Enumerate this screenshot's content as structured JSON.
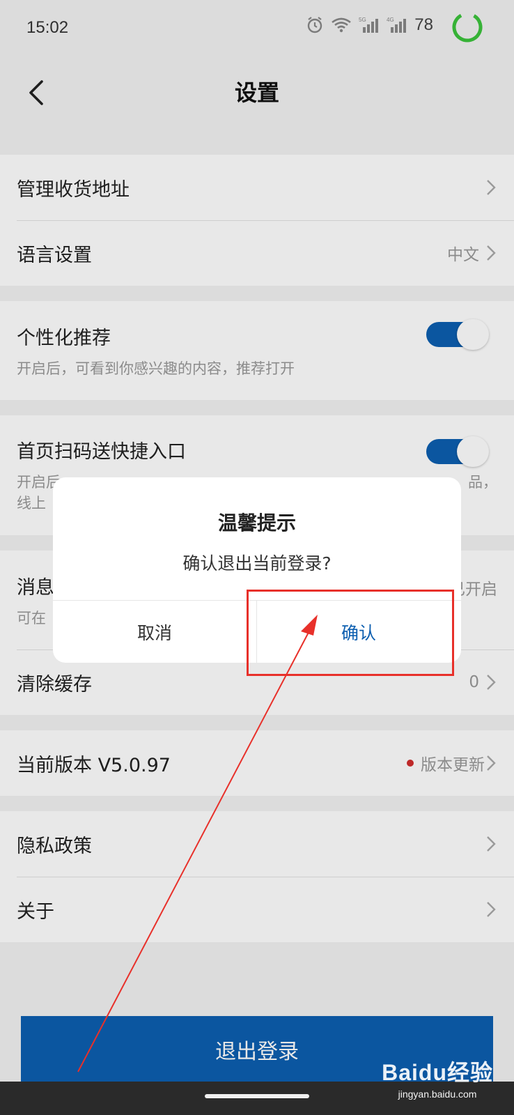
{
  "status_bar": {
    "time": "15:02",
    "battery_level": "78",
    "icons": [
      "alarm-icon",
      "wifi-icon",
      "signal-5g-icon",
      "signal-4g-icon"
    ]
  },
  "header": {
    "title": "设置"
  },
  "settings": {
    "address": {
      "label": "管理收货地址"
    },
    "language": {
      "label": "语言设置",
      "value": "中文"
    },
    "personalized": {
      "label": "个性化推荐",
      "desc": "开启后，可看到你感兴趣的内容，推荐打开",
      "enabled": true
    },
    "scan_shortcut": {
      "label": "首页扫码送快捷入口",
      "desc_line1": "开启后",
      "desc_line1_tail": "品，",
      "desc_line2": "线上",
      "enabled": true
    },
    "notification": {
      "label": "消息",
      "value_tail": "已开启",
      "desc": "可在"
    },
    "cache": {
      "label": "清除缓存",
      "value": "0"
    },
    "version": {
      "label": "当前版本 V5.0.97",
      "value": "版本更新"
    },
    "privacy": {
      "label": "隐私政策"
    },
    "about": {
      "label": "关于"
    }
  },
  "logout": {
    "label": "退出登录"
  },
  "dialog": {
    "title": "温馨提示",
    "message": "确认退出当前登录?",
    "cancel_label": "取消",
    "confirm_label": "确认"
  },
  "colors": {
    "accent": "#0d5fb0",
    "annotation": "#e8302a",
    "badge": "#d12d2d"
  },
  "watermark": {
    "logo": "Baidu经验",
    "url": "jingyan.baidu.com"
  }
}
